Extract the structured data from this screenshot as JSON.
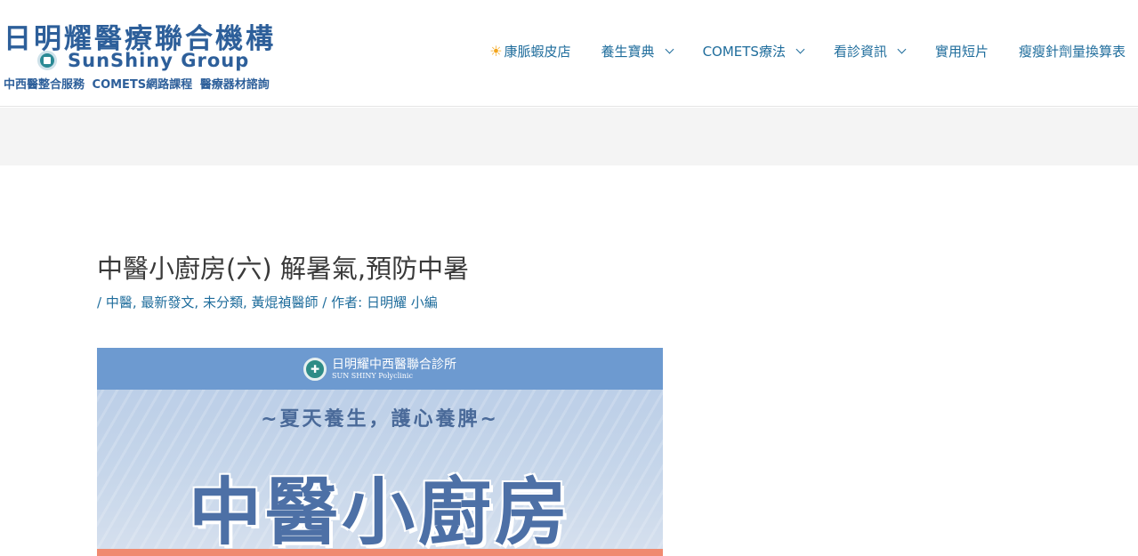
{
  "brand": {
    "name_zh": "日明耀醫療聯合機構",
    "name_en": "SunShiny Group",
    "tagline": "中西醫整合服務 COMETS網路課程 醫療器材諮詢",
    "colors": {
      "primary": "#2d5f9a",
      "link": "#1f6d9c",
      "sun": "#f3a51c"
    }
  },
  "nav": {
    "items": [
      {
        "label": "康脈蝦皮店",
        "icon": "sun-icon",
        "dropdown": false
      },
      {
        "label": "養生寶典",
        "dropdown": true
      },
      {
        "label": "COMETS療法",
        "dropdown": true
      },
      {
        "label": "看診資訊",
        "dropdown": true
      },
      {
        "label": "實用短片",
        "dropdown": false
      },
      {
        "label": "瘦瘦針劑量換算表",
        "dropdown": false
      }
    ]
  },
  "post": {
    "title": "中醫小廚房(六) 解暑氣,預防中暑",
    "meta_prefix": "/ ",
    "categories": [
      "中醫",
      "最新發文",
      "未分類",
      "黃焜禎醫師"
    ],
    "author_prefix": " / 作者: ",
    "author": "日明耀 小編"
  },
  "featured_image": {
    "clinic_name": "日明耀中西醫聯合診所",
    "clinic_en": "SUN SHINY Polyclinic",
    "slogan": "~夏天養生，護心養脾~",
    "headline": "中醫小廚房",
    "colors": {
      "top_bar": "#6d9ad0",
      "headline": "#4d70a6",
      "bottom_band": "#f08a70"
    }
  }
}
